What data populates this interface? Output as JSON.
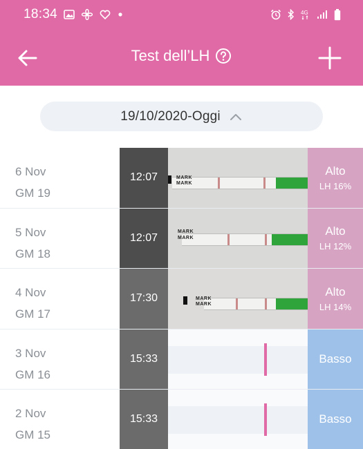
{
  "status_bar": {
    "time": "18:34",
    "left_icons": [
      "image-icon",
      "fan-icon",
      "heart-icon",
      "dot-icon"
    ],
    "right_icons": [
      "alarm-icon",
      "bluetooth-icon",
      "4g-icon",
      "signal-icon",
      "battery-icon"
    ],
    "network": "4G"
  },
  "header": {
    "title": "Test dell’LH",
    "back_icon": "arrow-left-icon",
    "help_icon": "help-circle-icon",
    "add_icon": "plus-icon"
  },
  "date_range": {
    "label": "19/10/2020-Oggi",
    "icon": "chevron-up-icon"
  },
  "colors": {
    "brand_pink": "#e06aa6",
    "high_result": "#d6a3c3",
    "low_result": "#9ec1e9",
    "pill_bg": "#eef1f5"
  },
  "tests": [
    {
      "date": "6 Nov",
      "cycle_day": "GM 19",
      "time": "12:07",
      "result": "Alto",
      "lh": "LH 16%",
      "level": "high",
      "has_photo": true
    },
    {
      "date": "5 Nov",
      "cycle_day": "GM 18",
      "time": "12:07",
      "result": "Alto",
      "lh": "LH 12%",
      "level": "high",
      "has_photo": true
    },
    {
      "date": "4 Nov",
      "cycle_day": "GM 17",
      "time": "17:30",
      "result": "Alto",
      "lh": "LH 14%",
      "level": "high",
      "has_photo": true
    },
    {
      "date": "3 Nov",
      "cycle_day": "GM 16",
      "time": "15:33",
      "result": "Basso",
      "lh": "",
      "level": "low",
      "has_photo": false
    },
    {
      "date": "2 Nov",
      "cycle_day": "GM 15",
      "time": "15:33",
      "result": "Basso",
      "lh": "",
      "level": "low",
      "has_photo": false
    }
  ],
  "strip_text": "MARK"
}
